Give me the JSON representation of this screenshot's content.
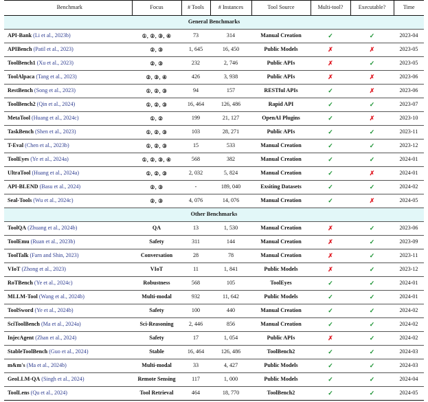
{
  "table": {
    "columns": [
      {
        "key": "benchmark",
        "label": "Benchmark"
      },
      {
        "key": "focus",
        "label": "Focus"
      },
      {
        "key": "tools",
        "label": "# Tools"
      },
      {
        "key": "instances",
        "label": "# Instances"
      },
      {
        "key": "source",
        "label": "Tool Source"
      },
      {
        "key": "multitool",
        "label": "Multi-tool?"
      },
      {
        "key": "executable",
        "label": "Executable?"
      },
      {
        "key": "time",
        "label": "Time"
      }
    ],
    "sections": [
      {
        "title": "General Benchmarks",
        "rows": [
          {
            "name": "API-Bank",
            "cite": "(Li et al., 2023b)",
            "focus": "①, ②, ③, ④",
            "tools": "73",
            "instances": "314",
            "source": "Manual Creation",
            "multitool": "✓",
            "executable": "✓",
            "time": "2023-04"
          },
          {
            "name": "APIBench",
            "cite": "(Patil et al., 2023)",
            "focus": "②, ③",
            "tools": "1, 645",
            "instances": "16, 450",
            "source": "Public Models",
            "multitool": "✗",
            "executable": "✗",
            "time": "2023-05"
          },
          {
            "name": "ToolBench1",
            "cite": "(Xu et al., 2023)",
            "focus": "②, ③",
            "tools": "232",
            "instances": "2, 746",
            "source": "Public APIs",
            "multitool": "✗",
            "executable": "✓",
            "time": "2023-05"
          },
          {
            "name": "ToolAlpaca",
            "cite": "(Tang et al., 2023)",
            "focus": "②, ③, ④",
            "tools": "426",
            "instances": "3, 938",
            "source": "Public APIs",
            "multitool": "✗",
            "executable": "✗",
            "time": "2023-06"
          },
          {
            "name": "RestBench",
            "cite": "(Song et al., 2023)",
            "focus": "①, ②, ③",
            "tools": "94",
            "instances": "157",
            "source": "RESTful APIs",
            "multitool": "✓",
            "executable": "✗",
            "time": "2023-06"
          },
          {
            "name": "ToolBench2",
            "cite": "(Qin et al., 2024)",
            "focus": "①, ②, ③",
            "tools": "16, 464",
            "instances": "126, 486",
            "source": "Rapid API",
            "multitool": "✓",
            "executable": "✓",
            "time": "2023-07"
          },
          {
            "name": "MetaTool",
            "cite": "(Huang et al., 2024c)",
            "focus": "①, ②",
            "tools": "199",
            "instances": "21, 127",
            "source": "OpenAI Plugins",
            "multitool": "✓",
            "executable": "✗",
            "time": "2023-10"
          },
          {
            "name": "TaskBench",
            "cite": "(Shen et al., 2023)",
            "focus": "①, ②, ③",
            "tools": "103",
            "instances": "28, 271",
            "source": "Public APIs",
            "multitool": "✓",
            "executable": "✓",
            "time": "2023-11"
          },
          {
            "name": "T-Eval",
            "cite": "(Chen et al., 2023b)",
            "focus": "①, ②, ③",
            "tools": "15",
            "instances": "533",
            "source": "Manual Creation",
            "multitool": "✓",
            "executable": "✓",
            "time": "2023-12"
          },
          {
            "name": "ToolEyes",
            "cite": "(Ye et al., 2024a)",
            "focus": "①, ②, ③, ④",
            "tools": "568",
            "instances": "382",
            "source": "Manual Creation",
            "multitool": "✓",
            "executable": "✓",
            "time": "2024-01"
          },
          {
            "name": "UltraTool",
            "cite": "(Huang et al., 2024a)",
            "focus": "①, ②, ③",
            "tools": "2, 032",
            "instances": "5, 824",
            "source": "Manual Creation",
            "multitool": "✓",
            "executable": "✗",
            "time": "2024-01"
          },
          {
            "name": "API-BLEND",
            "cite": "(Basu et al., 2024)",
            "focus": "②, ③",
            "tools": "-",
            "instances": "189, 040",
            "source": "Exsiting Datasets",
            "multitool": "✓",
            "executable": "✓",
            "time": "2024-02"
          },
          {
            "name": "Seal-Tools",
            "cite": "(Wu et al., 2024c)",
            "focus": "②, ③",
            "tools": "4, 076",
            "instances": "14, 076",
            "source": "Manual Creation",
            "multitool": "✓",
            "executable": "✗",
            "time": "2024-05"
          }
        ]
      },
      {
        "title": "Other Benchmarks",
        "rows": [
          {
            "name": "ToolQA",
            "cite": "(Zhuang et al., 2024b)",
            "focus": "QA",
            "tools": "13",
            "instances": "1, 530",
            "source": "Manual Creation",
            "multitool": "✗",
            "executable": "✓",
            "time": "2023-06"
          },
          {
            "name": "ToolEmu",
            "cite": "(Ruan et al., 2023b)",
            "focus": "Safety",
            "tools": "311",
            "instances": "144",
            "source": "Manual Creation",
            "multitool": "✗",
            "executable": "✓",
            "time": "2023-09"
          },
          {
            "name": "ToolTalk",
            "cite": "(Farn and Shin, 2023)",
            "focus": "Conversation",
            "tools": "28",
            "instances": "78",
            "source": "Manual Creation",
            "multitool": "✗",
            "executable": "✓",
            "time": "2023-11"
          },
          {
            "name": "VIoT",
            "cite": "(Zhong et al., 2023)",
            "focus": "VIoT",
            "tools": "11",
            "instances": "1, 841",
            "source": "Public Models",
            "multitool": "✗",
            "executable": "✓",
            "time": "2023-12"
          },
          {
            "name": "RoTBench",
            "cite": "(Ye et al., 2024c)",
            "focus": "Robustness",
            "tools": "568",
            "instances": "105",
            "source": "ToolEyes",
            "multitool": "✓",
            "executable": "✓",
            "time": "2024-01"
          },
          {
            "name": "MLLM-Tool",
            "cite": "(Wang et al., 2024b)",
            "focus": "Multi-modal",
            "tools": "932",
            "instances": "11, 642",
            "source": "Public Models",
            "multitool": "✓",
            "executable": "✓",
            "time": "2024-01"
          },
          {
            "name": "ToolSword",
            "cite": "(Ye et al., 2024b)",
            "focus": "Safety",
            "tools": "100",
            "instances": "440",
            "source": "Manual Creation",
            "multitool": "✓",
            "executable": "✓",
            "time": "2024-02"
          },
          {
            "name": "SciToolBench",
            "cite": "(Ma et al., 2024a)",
            "focus": "Sci-Reasoning",
            "tools": "2, 446",
            "instances": "856",
            "source": "Manual Creation",
            "multitool": "✓",
            "executable": "✓",
            "time": "2024-02"
          },
          {
            "name": "InjecAgent",
            "cite": "(Zhan et al., 2024)",
            "focus": "Safety",
            "tools": "17",
            "instances": "1, 054",
            "source": "Public APIs",
            "multitool": "✗",
            "executable": "✓",
            "time": "2024-02"
          },
          {
            "name": "StableToolBench",
            "cite": "(Guo et al., 2024)",
            "focus": "Stable",
            "tools": "16, 464",
            "instances": "126, 486",
            "source": "ToolBench2",
            "multitool": "✓",
            "executable": "✓",
            "time": "2024-03"
          },
          {
            "name": "m&m's",
            "cite": "(Ma et al., 2024b)",
            "focus": "Multi-modal",
            "tools": "33",
            "instances": "4, 427",
            "source": "Public Models",
            "multitool": "✓",
            "executable": "✓",
            "time": "2024-03"
          },
          {
            "name": "GeoLLM-QA",
            "cite": "(Singh et al., 2024)",
            "focus": "Remote Sensing",
            "tools": "117",
            "instances": "1, 000",
            "source": "Public Models",
            "multitool": "✓",
            "executable": "✓",
            "time": "2024-04"
          },
          {
            "name": "ToolLens",
            "cite": "(Qu et al., 2024)",
            "focus": "Tool Retrieval",
            "tools": "464",
            "instances": "18, 770",
            "source": "ToolBench2",
            "multitool": "✓",
            "executable": "✓",
            "time": "2024-05"
          }
        ]
      }
    ]
  },
  "colors": {
    "citation": "#2b3a8f",
    "section_band": "#e2f7f8",
    "yes": "#17912f",
    "no": "#e01b24",
    "rule": "#111111"
  },
  "glyphs": {
    "check": "✓",
    "cross": "✗"
  }
}
